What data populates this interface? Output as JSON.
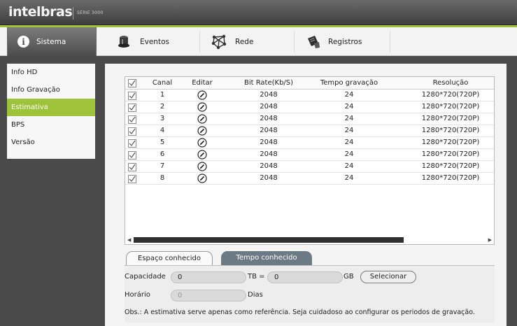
{
  "header": {
    "logo": "intelbras",
    "series": "SÉRIE 3000"
  },
  "tabs": [
    {
      "label": "Sistema",
      "icon": "info-icon",
      "active": true
    },
    {
      "label": "Eventos",
      "icon": "alarm-light-icon",
      "active": false
    },
    {
      "label": "Rede",
      "icon": "network-icon",
      "active": false
    },
    {
      "label": "Registros",
      "icon": "document-icon",
      "active": false
    }
  ],
  "sidebar": {
    "items": [
      {
        "label": "Info HD",
        "active": false
      },
      {
        "label": "Info Gravação",
        "active": false
      },
      {
        "label": "Estimativa",
        "active": true
      },
      {
        "label": "BPS",
        "active": false
      },
      {
        "label": "Versão",
        "active": false
      }
    ]
  },
  "table": {
    "columns": [
      "Canal",
      "Editar",
      "Bit Rate(Kb/S)",
      "Tempo gravação",
      "Resolução"
    ],
    "rows": [
      {
        "canal": "1",
        "bitrate": "2048",
        "tempo": "24",
        "resolucao": "1280*720(720P)",
        "checked": true
      },
      {
        "canal": "2",
        "bitrate": "2048",
        "tempo": "24",
        "resolucao": "1280*720(720P)",
        "checked": true
      },
      {
        "canal": "3",
        "bitrate": "2048",
        "tempo": "24",
        "resolucao": "1280*720(720P)",
        "checked": true
      },
      {
        "canal": "4",
        "bitrate": "2048",
        "tempo": "24",
        "resolucao": "1280*720(720P)",
        "checked": true
      },
      {
        "canal": "5",
        "bitrate": "2048",
        "tempo": "24",
        "resolucao": "1280*720(720P)",
        "checked": true
      },
      {
        "canal": "6",
        "bitrate": "2048",
        "tempo": "24",
        "resolucao": "1280*720(720P)",
        "checked": true
      },
      {
        "canal": "7",
        "bitrate": "2048",
        "tempo": "24",
        "resolucao": "1280*720(720P)",
        "checked": true
      },
      {
        "canal": "8",
        "bitrate": "2048",
        "tempo": "24",
        "resolucao": "1280*720(720P)",
        "checked": true
      }
    ]
  },
  "subtabs": {
    "known_space": "Espaço conhecido",
    "known_time": "Tempo conhecido"
  },
  "form": {
    "capacity_label": "Capacidade",
    "capacity_value": "0",
    "tb_label": "TB =",
    "gb_value": "0",
    "gb_label": "GB",
    "select_button": "Selecionar",
    "time_label": "Horário",
    "time_value": "0",
    "days_label": "Dias",
    "note": "Obs.: A estimativa serve apenas como referência. Seja cuidadoso ao configurar os periodos de gravação."
  },
  "colors": {
    "accent": "#9ec33a",
    "active_subtab": "#6c7a86"
  }
}
